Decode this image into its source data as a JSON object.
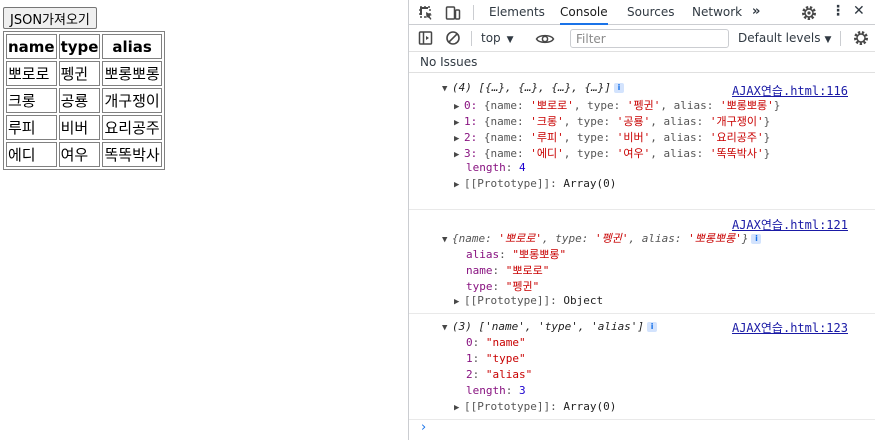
{
  "page": {
    "button_label": "JSON가져오기",
    "table": {
      "headers": [
        "name",
        "type",
        "alias"
      ],
      "rows": [
        [
          "뽀로로",
          "펭귄",
          "뽀롱뽀롱"
        ],
        [
          "크롱",
          "공룡",
          "개구쟁이"
        ],
        [
          "루피",
          "비버",
          "요리공주"
        ],
        [
          "에디",
          "여우",
          "똑똑박사"
        ]
      ]
    }
  },
  "devtools": {
    "tabs": [
      "Elements",
      "Console",
      "Sources",
      "Network"
    ],
    "active_tab": "Console",
    "context": "top",
    "filter_placeholder": "Filter",
    "levels_label": "Default levels",
    "issues_text": "No Issues",
    "messages": [
      {
        "source": "AJAX연습.html:116",
        "summary": "(4) [{…}, {…}, {…}, {…}]",
        "items": [
          {
            "index": "0",
            "name": "'뽀로로'",
            "type": "'펭귄'",
            "alias": "'뽀롱뽀롱'"
          },
          {
            "index": "1",
            "name": "'크롱'",
            "type": "'공룡'",
            "alias": "'개구쟁이'"
          },
          {
            "index": "2",
            "name": "'루피'",
            "type": "'비버'",
            "alias": "'요리공주'"
          },
          {
            "index": "3",
            "name": "'에디'",
            "type": "'여우'",
            "alias": "'똑똑박사'"
          }
        ],
        "length_value": "4",
        "prototype": "Array(0)"
      },
      {
        "source": "AJAX연습.html:121",
        "summary_name": "'뽀로로'",
        "summary_type": "'펭귄'",
        "summary_alias": "'뽀롱뽀롱'",
        "props": [
          {
            "key": "alias",
            "value": "\"뽀롱뽀롱\""
          },
          {
            "key": "name",
            "value": "\"뽀로로\""
          },
          {
            "key": "type",
            "value": "\"펭귄\""
          }
        ],
        "prototype": "Object"
      },
      {
        "source": "AJAX연습.html:123",
        "summary": "(3) ['name', 'type', 'alias']",
        "items": [
          {
            "key": "0",
            "value": "\"name\""
          },
          {
            "key": "1",
            "value": "\"type\""
          },
          {
            "key": "2",
            "value": "\"alias\""
          }
        ],
        "length_value": "3",
        "prototype": "Array(0)"
      }
    ],
    "prompt": "›"
  }
}
